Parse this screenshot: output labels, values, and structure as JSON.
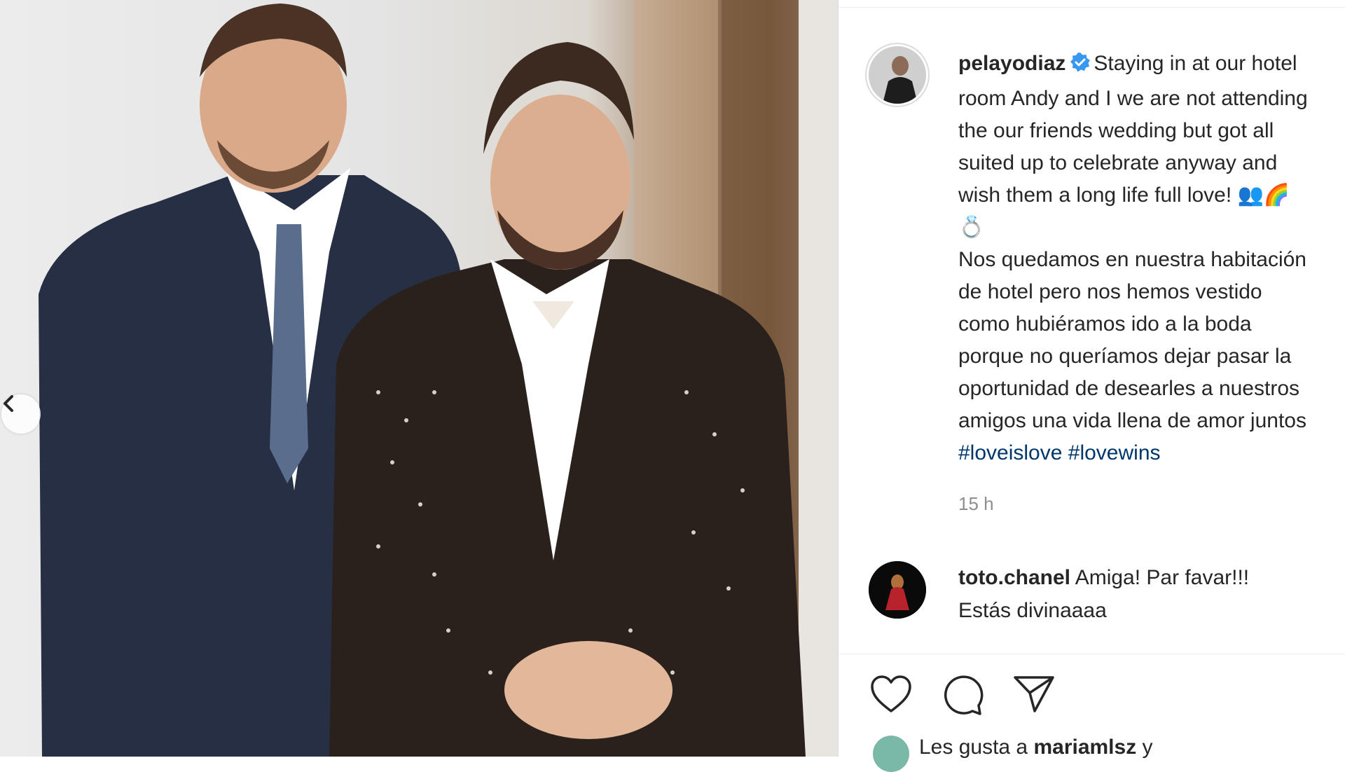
{
  "post": {
    "author": "pelayodiaz",
    "caption_lines_en": [
      "Staying in at our hotel",
      "room Andy and I we are not attending",
      "the our friends wedding but got all",
      "suited up to celebrate anyway and",
      "wish them a long life full love! 👥🌈"
    ],
    "caption_emoji_line": "💍",
    "caption_lines_es": [
      "Nos quedamos en nuestra habitación",
      "de hotel pero nos hemos vestido",
      "como hubiéramos ido a la boda",
      "porque no queríamos dejar pasar la",
      "oportunidad de desearles a nuestros",
      "amigos una vida llena de amor juntos"
    ],
    "hashtags": [
      "#loveislove",
      "#lovewins"
    ],
    "timestamp": "15 h"
  },
  "comment": {
    "author": "toto.chanel",
    "text_line1": "Amiga! Par favar!!!",
    "text_line2": "Estás divinaaaa"
  },
  "likes": {
    "prefix": "Les gusta a ",
    "user": "mariamlsz",
    "suffix": " y"
  },
  "icons": {
    "verified": "verified-badge-icon",
    "prev": "chevron-left-icon",
    "like": "heart-icon",
    "comment": "comment-bubble-icon",
    "share": "paper-plane-icon"
  },
  "colors": {
    "verified": "#3897f0",
    "hashtag": "#00376b",
    "muted": "#8e8e8e"
  }
}
